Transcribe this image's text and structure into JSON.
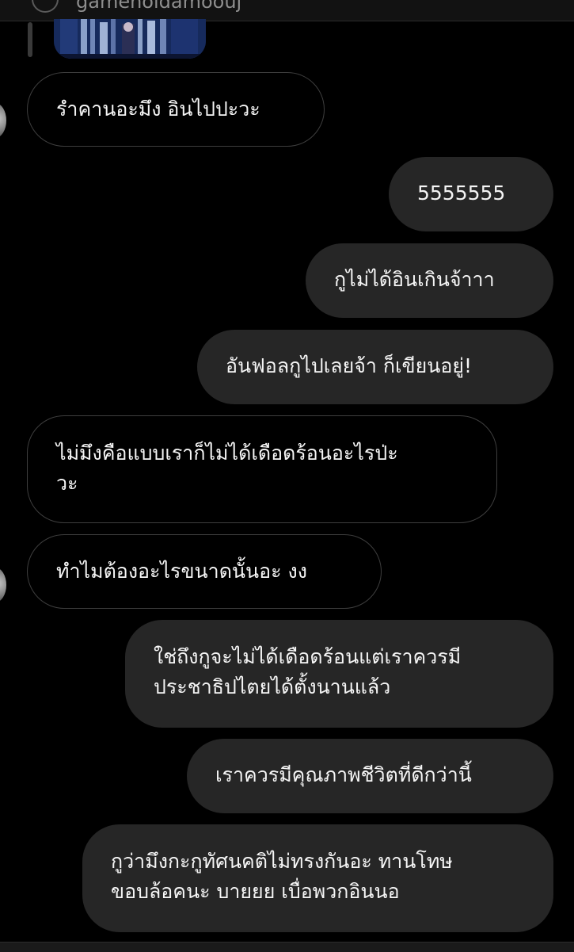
{
  "header": {
    "username_partial": "gameholdamoouj"
  },
  "messages": [
    {
      "sender": "them",
      "text": "รำคานอะมึง อินไปปะวะ"
    },
    {
      "sender": "me",
      "text": "5555555"
    },
    {
      "sender": "me",
      "text": "กูไม่ได้อินเกินจ้าาา"
    },
    {
      "sender": "me",
      "text": "อันฟอลกูไปเลยจ้า ก็เขียนอยู่!"
    },
    {
      "sender": "them",
      "text": "ไม่มึงคือแบบเราก็ไม่ได้เดือดร้อนอะไรป่ะ\nวะ"
    },
    {
      "sender": "them",
      "text": "ทำไมต้องอะไรขนาดนั้นอะ งง"
    },
    {
      "sender": "me",
      "text": "ใช่ถึงกูจะไม่ได้เดือดร้อนแต่เราควรมี\nประชาธิปไตยได้ตั้งนานแล้ว"
    },
    {
      "sender": "me",
      "text": "เราควรมีคุณภาพชีวิตที่ดีกว่านี้"
    },
    {
      "sender": "me",
      "text": "กูว่ามึงกะกูทัศนคติไม่ทรงกันอะ ทานโทษ\nขอบล้อคนะ บายยย เบื่อพวกอินนอ"
    }
  ],
  "colors": {
    "background": "#000000",
    "sent_bubble": "#262626",
    "received_border": "#3e3e3e",
    "text": "#f5f5f5"
  }
}
